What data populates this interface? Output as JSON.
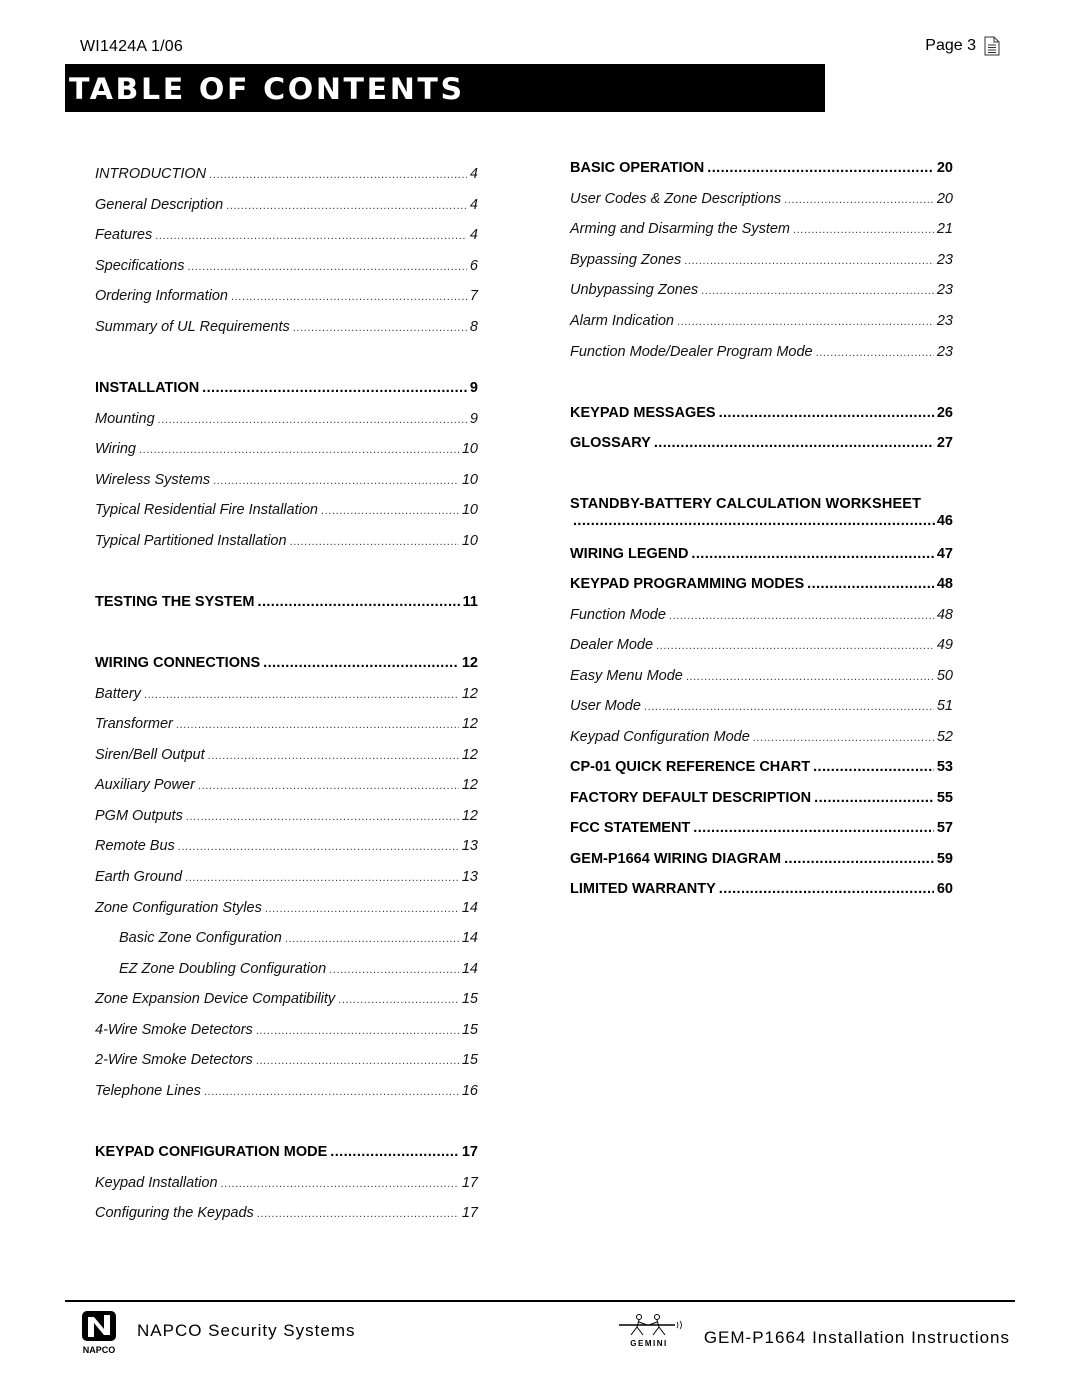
{
  "header": {
    "doc_id": "WI1424A  1/06",
    "page_label": "Page 3",
    "page_icon": "document-icon",
    "title": "TABLE OF CONTENTS"
  },
  "left_column": [
    {
      "label": "INTRODUCTION",
      "page": "4",
      "style": "sub"
    },
    {
      "label": "General Description",
      "page": "4",
      "style": "sub"
    },
    {
      "label": "Features",
      "page": "4",
      "style": "sub"
    },
    {
      "label": "Specifications",
      "page": "6",
      "style": "sub"
    },
    {
      "label": "Ordering Information",
      "page": "7",
      "style": "sub"
    },
    {
      "label": "Summary of UL Requirements",
      "page": "8",
      "style": "sub"
    },
    {
      "label": "INSTALLATION",
      "page": "9",
      "style": "head"
    },
    {
      "label": "Mounting",
      "page": "9",
      "style": "sub"
    },
    {
      "label": "Wiring",
      "page": "10",
      "style": "sub"
    },
    {
      "label": "Wireless Systems",
      "page": "10",
      "style": "sub"
    },
    {
      "label": "Typical Residential Fire Installation",
      "page": "10",
      "style": "sub"
    },
    {
      "label": "Typical Partitioned Installation",
      "page": "10",
      "style": "sub"
    },
    {
      "label": "TESTING THE SYSTEM",
      "page": "11",
      "style": "head"
    },
    {
      "label": "WIRING CONNECTIONS",
      "page": "12",
      "style": "head"
    },
    {
      "label": "Battery",
      "page": "12",
      "style": "sub"
    },
    {
      "label": "Transformer",
      "page": "12",
      "style": "sub"
    },
    {
      "label": "Siren/Bell Output",
      "page": "12",
      "style": "sub"
    },
    {
      "label": "Auxiliary Power",
      "page": "12",
      "style": "sub"
    },
    {
      "label": "PGM Outputs",
      "page": "12",
      "style": "sub"
    },
    {
      "label": "Remote Bus",
      "page": "13",
      "style": "sub"
    },
    {
      "label": "Earth Ground",
      "page": "13",
      "style": "sub"
    },
    {
      "label": "Zone Configuration Styles",
      "page": "14",
      "style": "sub"
    },
    {
      "label": "Basic Zone Configuration",
      "page": "14",
      "style": "sub indent"
    },
    {
      "label": "EZ Zone Doubling Configuration",
      "page": "14",
      "style": "sub indent"
    },
    {
      "label": "Zone Expansion Device Compatibility",
      "page": "15",
      "style": "sub"
    },
    {
      "label": "4-Wire Smoke Detectors",
      "page": "15",
      "style": "sub"
    },
    {
      "label": "2-Wire Smoke Detectors",
      "page": "15",
      "style": "sub"
    },
    {
      "label": "Telephone Lines",
      "page": "16",
      "style": "sub"
    },
    {
      "label": "KEYPAD CONFIGURATION MODE",
      "page": "17",
      "style": "head"
    },
    {
      "label": "Keypad Installation",
      "page": "17",
      "style": "sub"
    },
    {
      "label": "Configuring the Keypads",
      "page": "17",
      "style": "sub"
    }
  ],
  "right_column": [
    {
      "label": "BASIC OPERATION",
      "page": "20",
      "style": "head"
    },
    {
      "label": "User Codes & Zone Descriptions",
      "page": "20",
      "style": "sub"
    },
    {
      "label": "Arming and Disarming the System",
      "page": "21",
      "style": "sub"
    },
    {
      "label": "Bypassing Zones",
      "page": "23",
      "style": "sub"
    },
    {
      "label": "Unbypassing Zones",
      "page": "23",
      "style": "sub"
    },
    {
      "label": "Alarm Indication",
      "page": "23",
      "style": "sub"
    },
    {
      "label": "Function Mode/Dealer Program Mode",
      "page": "23",
      "style": "sub"
    },
    {
      "label": "KEYPAD MESSAGES",
      "page": "26",
      "style": "head"
    },
    {
      "label": "GLOSSARY",
      "page": "27",
      "style": "head"
    },
    {
      "label": "STANDBY-BATTERY CALCULATION WORKSHEET",
      "page": "46",
      "style": "head wrap"
    },
    {
      "label": "WIRING LEGEND",
      "page": "47",
      "style": "head"
    },
    {
      "label": "KEYPAD PROGRAMMING MODES",
      "page": "48",
      "style": "head"
    },
    {
      "label": "Function Mode",
      "page": "48",
      "style": "sub"
    },
    {
      "label": "Dealer Mode",
      "page": "49",
      "style": "sub"
    },
    {
      "label": "Easy Menu Mode",
      "page": "50",
      "style": "sub"
    },
    {
      "label": "User Mode",
      "page": "51",
      "style": "sub"
    },
    {
      "label": "Keypad Configuration Mode",
      "page": "52",
      "style": "sub"
    },
    {
      "label": "CP-01 QUICK REFERENCE CHART",
      "page": "53",
      "style": "head"
    },
    {
      "label": "FACTORY DEFAULT DESCRIPTION",
      "page": "55",
      "style": "head"
    },
    {
      "label": "FCC STATEMENT",
      "page": "57",
      "style": "head"
    },
    {
      "label": "GEM-P1664 WIRING DIAGRAM",
      "page": "59",
      "style": "head"
    },
    {
      "label": "LIMITED WARRANTY",
      "page": "60",
      "style": "head"
    }
  ],
  "footer": {
    "left_logo": "napco-logo",
    "left_logo_text": "NAPCO",
    "company": "NAPCO Security Systems",
    "right_logo": "gemini-logo",
    "right_logo_text": "GEMINI",
    "doc_title": "GEM-P1664 Installation Instructions"
  }
}
